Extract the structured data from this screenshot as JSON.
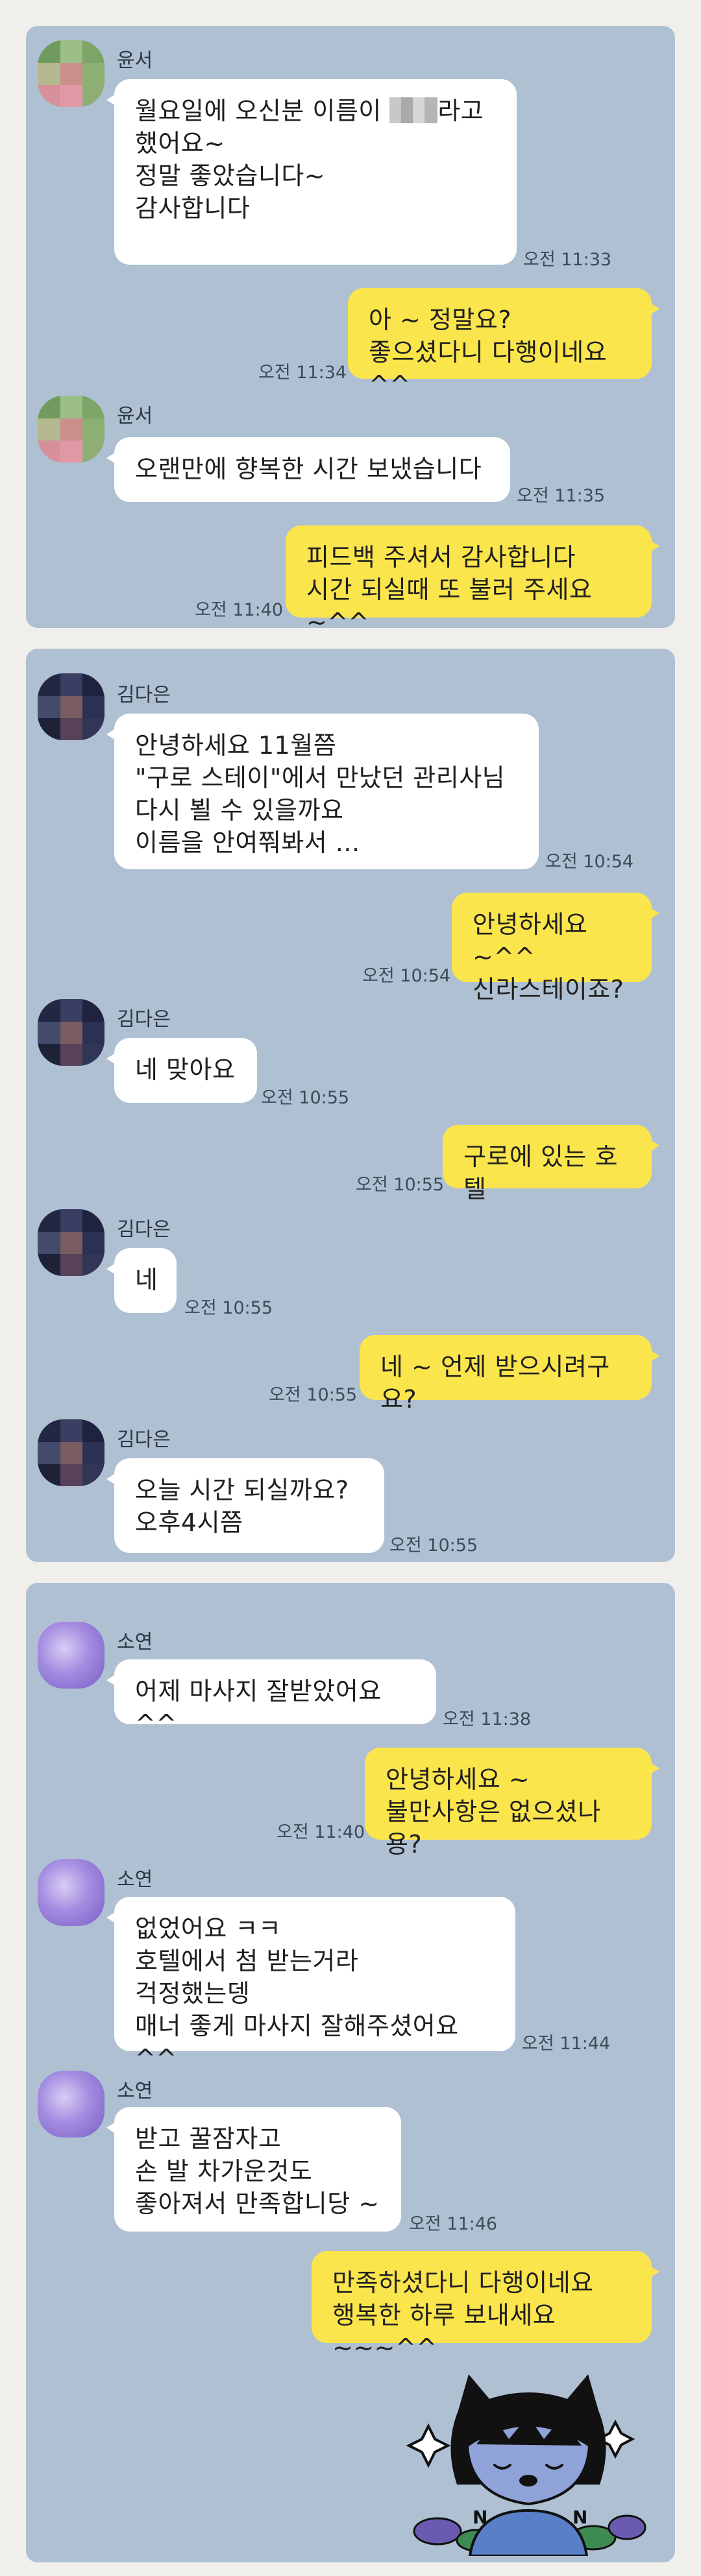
{
  "panels": [
    {
      "messages": [
        {
          "side": "in",
          "sender": "윤서",
          "text_before": "월요일에 오신분 이름이 ",
          "text_after": "라고\n했어요~\n정말 좋았습니다~\n감사합니다",
          "time": "오전 11:33"
        },
        {
          "side": "out",
          "text": "아 ~ 정말요?\n좋으셨다니 다행이네요 ^^",
          "time": "오전 11:34"
        },
        {
          "side": "in",
          "sender": "윤서",
          "text": "오랜만에 향복한 시간 보냈습니다",
          "time": "오전 11:35"
        },
        {
          "side": "out",
          "text": "피드백 주셔서 감사합니다\n시간 되실때 또 불러 주세요 ~^^",
          "time": "오전 11:40"
        }
      ]
    },
    {
      "messages": [
        {
          "side": "in",
          "sender": "김다은",
          "text": "안녕하세요 11월쯤\n\"구로 스테이\"에서 만났던 관리사님\n다시 뵐 수 있을까요\n이름을 안여쭤봐서 ...",
          "time": "오전 10:54"
        },
        {
          "side": "out",
          "text": "안녕하세요 ~^^\n신라스테이죠?",
          "time": "오전 10:54"
        },
        {
          "side": "in",
          "sender": "김다은",
          "text": "네 맞아요",
          "time": "오전 10:55"
        },
        {
          "side": "out",
          "text": "구로에 있는 호텔",
          "time": "오전 10:55"
        },
        {
          "side": "in",
          "sender": "김다은",
          "text": "네",
          "time": "오전 10:55"
        },
        {
          "side": "out",
          "text": "네 ~ 언제 받으시려구요?",
          "time": "오전 10:55"
        },
        {
          "side": "in",
          "sender": "김다은",
          "text": "오늘  시간 되실까요?\n오후4시쯤",
          "time": "오전 10:55"
        }
      ]
    },
    {
      "messages": [
        {
          "side": "in",
          "sender": "소연",
          "text": "어제 마사지 잘받았어요 ^^",
          "time": "오전 11:38"
        },
        {
          "side": "out",
          "text": "안녕하세요 ~\n불만사항은 없으셨나용?",
          "time": "오전 11:40"
        },
        {
          "side": "in",
          "sender": "소연",
          "text": "없었어요 ㅋㅋ\n호텔에서 첨 받는거라\n걱정했는뎅\n매너 좋게 마사지 잘해주셨어요 ^^",
          "time": "오전 11:44"
        },
        {
          "side": "in",
          "sender": "소연",
          "text": "받고 꿀잠자고\n손 발 차가운것도\n좋아져서 만족합니당 ~",
          "time": "오전 11:46"
        },
        {
          "side": "out",
          "text": "만족하셨다니 다행이네요\n행복한 하루 보내세요 ~~~^^",
          "time": "오전 11:46"
        }
      ]
    }
  ],
  "sticker": {
    "icon": "kakao-friends-character-sticker"
  },
  "colors": {
    "panel_bg": "#afc0d3",
    "outgoing_bubble": "#fbe54d",
    "incoming_bubble": "#ffffff",
    "page_bg": "#f1efeb"
  }
}
